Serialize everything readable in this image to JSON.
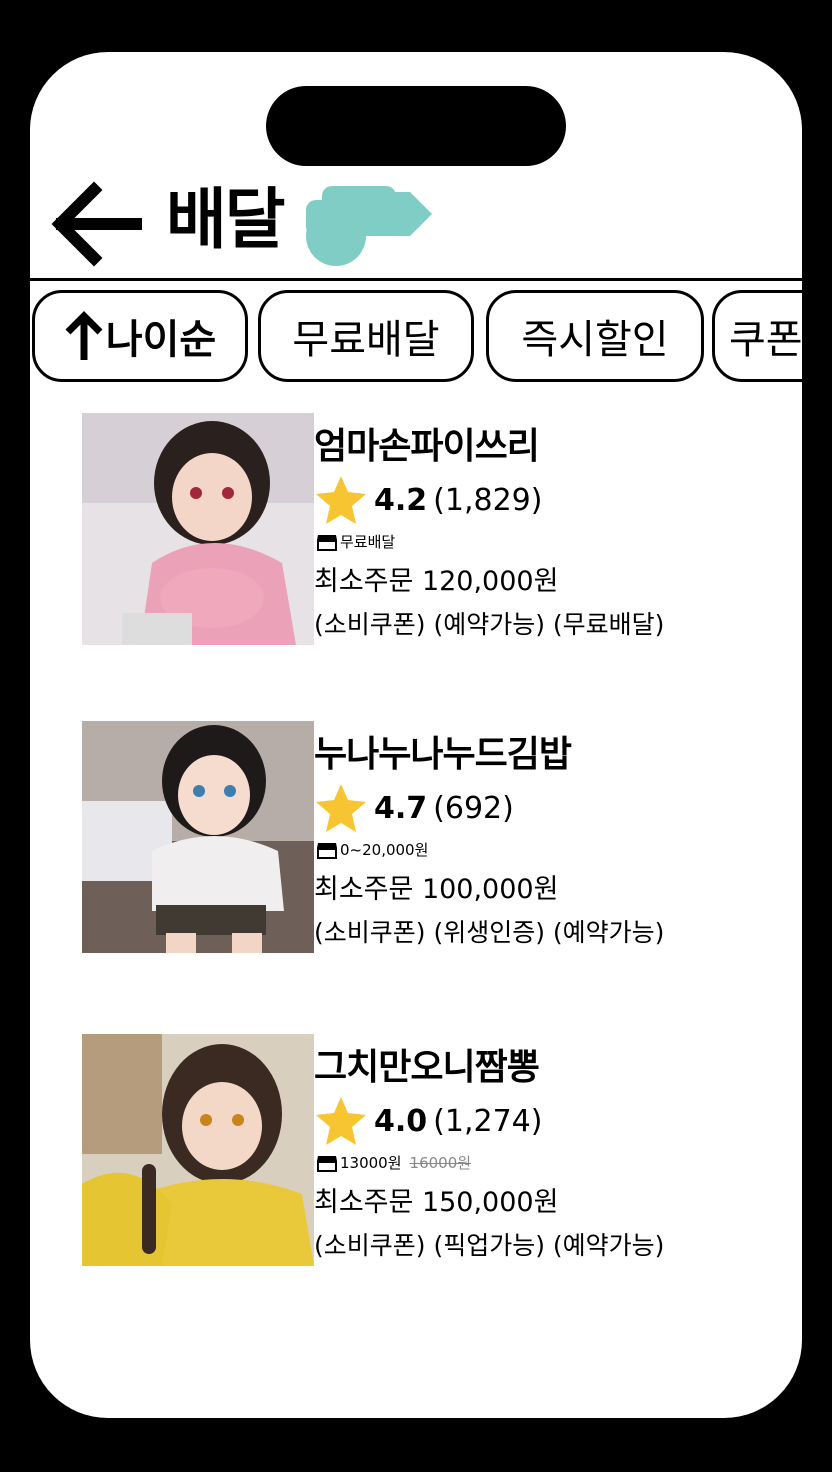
{
  "header": {
    "title": "배달"
  },
  "sort_chip": {
    "label": "나이순"
  },
  "filter_chips": [
    "무료배달",
    "즉시할인",
    "쿠폰"
  ],
  "colors": {
    "accent": "#7fcdc4",
    "star": "#f7c531"
  },
  "stores": [
    {
      "name": "엄마손파이쓰리",
      "rating": "4.2",
      "reviews": "(1,829)",
      "delivery_fee": "무료배달",
      "delivery_fee_old": "",
      "min_order": "최소주문 120,000원",
      "tags": "(소비쿠폰) (예약가능) (무료배달)"
    },
    {
      "name": "누나누나누드김밥",
      "rating": "4.7",
      "reviews": "(692)",
      "delivery_fee": "0~20,000원",
      "delivery_fee_old": "",
      "min_order": "최소주문 100,000원",
      "tags": "(소비쿠폰) (위생인증) (예약가능)"
    },
    {
      "name": "그치만오니짬뽕",
      "rating": "4.0",
      "reviews": "(1,274)",
      "delivery_fee": "13000원",
      "delivery_fee_old": "16000원",
      "min_order": "최소주문 150,000원",
      "tags": "(소비쿠폰) (픽업가능) (예약가능)"
    }
  ]
}
